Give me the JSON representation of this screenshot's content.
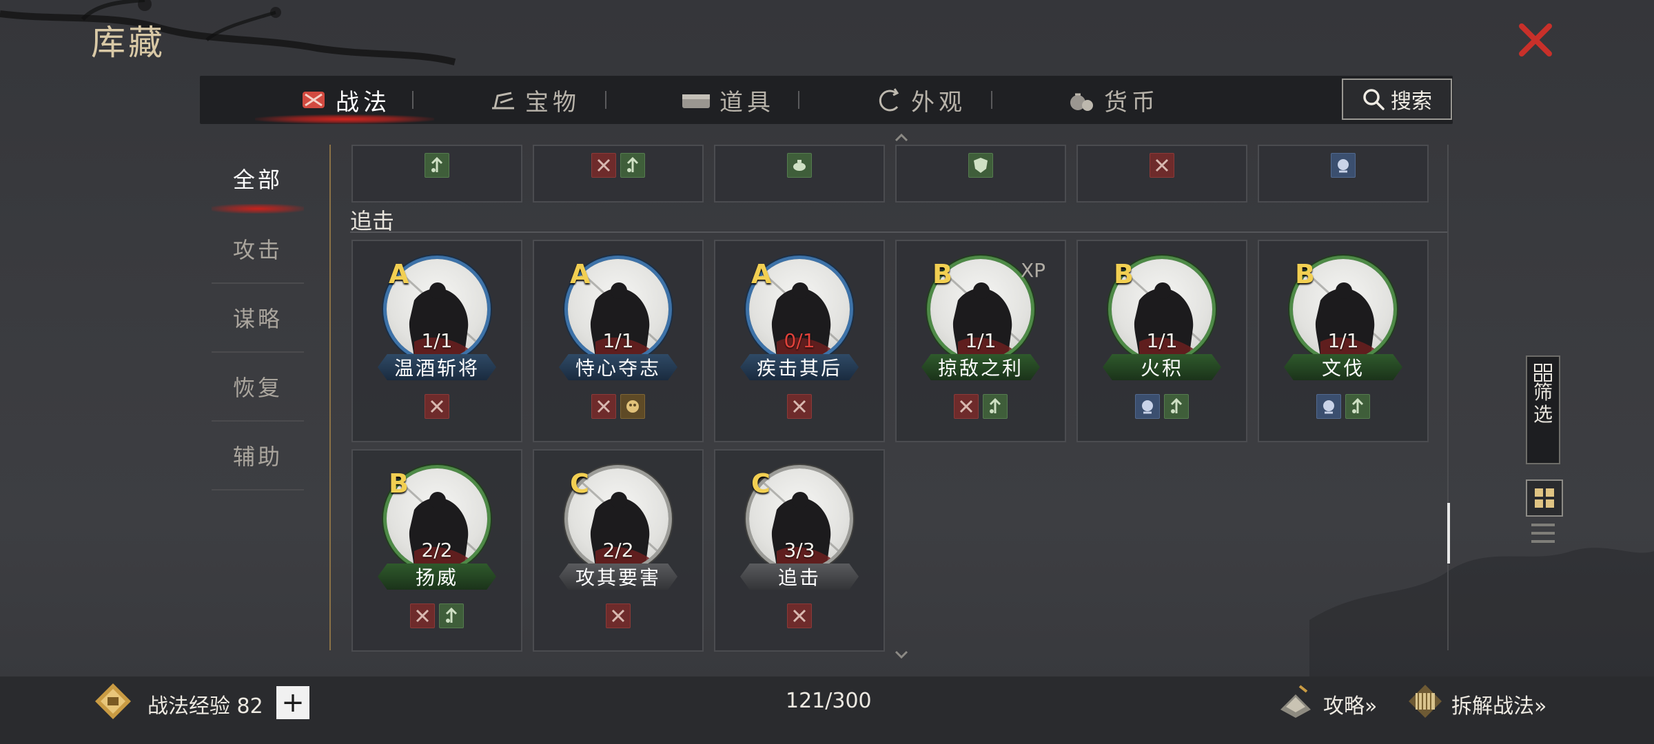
{
  "window": {
    "title": "库藏"
  },
  "tabs": [
    {
      "label": "战法",
      "icon": "scroll-bundle-icon",
      "active": true
    },
    {
      "label": "宝物",
      "icon": "treasure-icon",
      "active": false
    },
    {
      "label": "道具",
      "icon": "chest-icon",
      "active": false
    },
    {
      "label": "外观",
      "icon": "appearance-icon",
      "active": false
    },
    {
      "label": "货币",
      "icon": "money-bag-icon",
      "active": false
    }
  ],
  "search": {
    "label": "搜索"
  },
  "categories": [
    {
      "label": "全部",
      "active": true
    },
    {
      "label": "攻击",
      "active": false
    },
    {
      "label": "谋略",
      "active": false
    },
    {
      "label": "恢复",
      "active": false
    },
    {
      "label": "辅助",
      "active": false
    }
  ],
  "section": {
    "label": "追击"
  },
  "top_row_tags": [
    [
      "green-up"
    ],
    [
      "red-cross",
      "green-up"
    ],
    [
      "green-teapot"
    ],
    [
      "green-shield"
    ],
    [
      "red-cross"
    ],
    [
      "blue-palm"
    ]
  ],
  "cards": [
    {
      "grade": "A",
      "count": "1/1",
      "count_red": false,
      "name": "温酒斩将",
      "ring": "A",
      "bar": "blue",
      "xp": "",
      "tags": [
        "red-cross"
      ]
    },
    {
      "grade": "A",
      "count": "1/1",
      "count_red": false,
      "name": "恃心夺志",
      "ring": "A",
      "bar": "blue",
      "xp": "",
      "tags": [
        "red-cross",
        "gold-mask"
      ]
    },
    {
      "grade": "A",
      "count": "0/1",
      "count_red": true,
      "name": "疾击其后",
      "ring": "A",
      "bar": "blue",
      "xp": "",
      "tags": [
        "red-cross"
      ]
    },
    {
      "grade": "B",
      "count": "1/1",
      "count_red": false,
      "name": "掠敌之利",
      "ring": "B",
      "bar": "green",
      "xp": "XP",
      "tags": [
        "red-cross",
        "green-up"
      ]
    },
    {
      "grade": "B",
      "count": "1/1",
      "count_red": false,
      "name": "火积",
      "ring": "B",
      "bar": "green",
      "xp": "",
      "tags": [
        "blue-palm",
        "green-up"
      ]
    },
    {
      "grade": "B",
      "count": "1/1",
      "count_red": false,
      "name": "文伐",
      "ring": "B",
      "bar": "green",
      "xp": "",
      "tags": [
        "blue-palm",
        "green-up"
      ]
    },
    {
      "grade": "B",
      "count": "2/2",
      "count_red": false,
      "name": "扬威",
      "ring": "B",
      "bar": "green",
      "xp": "",
      "tags": [
        "red-cross",
        "green-up"
      ]
    },
    {
      "grade": "C",
      "count": "2/2",
      "count_red": false,
      "name": "攻其要害",
      "ring": "C",
      "bar": "gray",
      "xp": "",
      "tags": [
        "red-cross"
      ]
    },
    {
      "grade": "C",
      "count": "3/3",
      "count_red": false,
      "name": "追击",
      "ring": "C",
      "bar": "gray",
      "xp": "",
      "tags": [
        "red-cross"
      ]
    }
  ],
  "side": {
    "filter_label_1": "筛",
    "filter_label_2": "选"
  },
  "footer": {
    "exp_label": "战法经验 82",
    "capacity": "121/300",
    "guide_label": "攻略»",
    "disassemble_label": "拆解战法»"
  },
  "colors": {
    "accent_red": "#d0241e",
    "grade_gold": "#f2cf52",
    "count_red": "#e0413a"
  }
}
